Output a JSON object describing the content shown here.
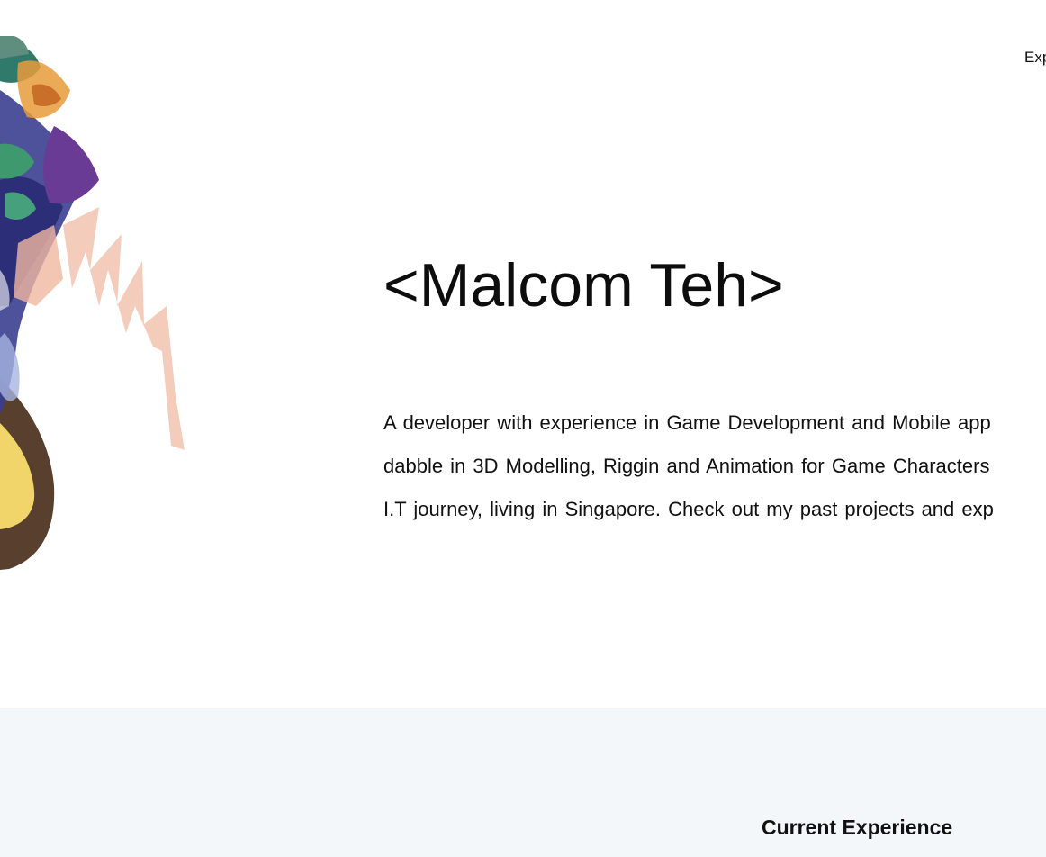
{
  "nav": {
    "experience_label": "Exp"
  },
  "hero": {
    "title": "<Malcom Teh>",
    "description_lines": [
      "A developer with experience in Game Development and Mobile app",
      "dabble in 3D Modelling, Riggin and Animation for Game Characters",
      "I.T journey, living in Singapore. Check out my past projects and exp"
    ],
    "artwork_icon": "watercolor-illustration"
  },
  "experience": {
    "heading": "Current Experience",
    "background_color": "#f4f7fa"
  }
}
